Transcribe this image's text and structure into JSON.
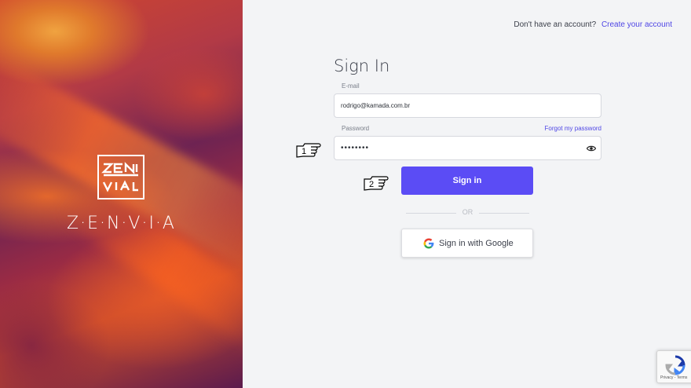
{
  "brand": {
    "wordmark": "Z·E·N·V·I·A",
    "logo_glyph": "ZEN VIA"
  },
  "header": {
    "prompt": "Don't have an account?",
    "create_link": "Create your account"
  },
  "form": {
    "title": "Sign In",
    "email": {
      "label": "E-mail",
      "value": "rodrigo@kamada.com.br"
    },
    "password": {
      "label": "Password",
      "forgot_link": "Forgot my password",
      "masked_value": "••••••••"
    },
    "sign_in_label": "Sign in",
    "separator": "OR",
    "google_label": "Sign in with Google"
  },
  "annotations": {
    "step1": "1",
    "step2": "2"
  },
  "recaptcha": {
    "links": "Privacy - Terms"
  },
  "colors": {
    "accent": "#5b4cf5",
    "link": "#4f46e5"
  }
}
